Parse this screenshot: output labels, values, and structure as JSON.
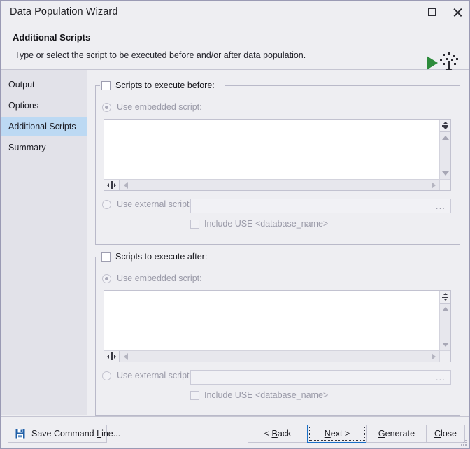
{
  "window": {
    "title": "Data Population Wizard",
    "maximize_icon": "maximize-icon",
    "close_icon": "close-icon"
  },
  "header": {
    "title": "Additional Scripts",
    "subtitle": "Type or select the script to be executed before and/or after data population.",
    "artwork_icon": "data-population-icon"
  },
  "sidebar": {
    "items": [
      {
        "label": "Output",
        "selected": false
      },
      {
        "label": "Options",
        "selected": false
      },
      {
        "label": "Additional Scripts",
        "selected": true
      },
      {
        "label": "Summary",
        "selected": false
      }
    ]
  },
  "groups": [
    {
      "id": "before",
      "title": "Scripts to execute before:",
      "checked": false,
      "embedded": {
        "label": "Use embedded script:",
        "selected": true,
        "editor_value": ""
      },
      "external": {
        "label": "Use external script:",
        "selected": false,
        "path_value": "",
        "browse_label": "...",
        "include_use_label": "Include USE <database_name>",
        "include_use_checked": false
      }
    },
    {
      "id": "after",
      "title": "Scripts to execute after:",
      "checked": false,
      "embedded": {
        "label": "Use embedded script:",
        "selected": true,
        "editor_value": ""
      },
      "external": {
        "label": "Use external script:",
        "selected": false,
        "path_value": "",
        "browse_label": "...",
        "include_use_label": "Include USE <database_name>",
        "include_use_checked": false
      }
    }
  ],
  "footer": {
    "save_command_line": "Save Command Line...",
    "save_icon": "floppy-disk-icon",
    "back": "< Back",
    "next": "Next >",
    "generate": "Generate",
    "close": "Close"
  },
  "colors": {
    "window_bg": "#eeeef2",
    "sidebar_bg": "#e2e2e9",
    "selection": "#bcd9f3",
    "focus_border": "#1a70c8",
    "accent_green": "#2d8b3c",
    "save_blue": "#1f5fa8",
    "disabled_text": "#9a9aa8"
  }
}
